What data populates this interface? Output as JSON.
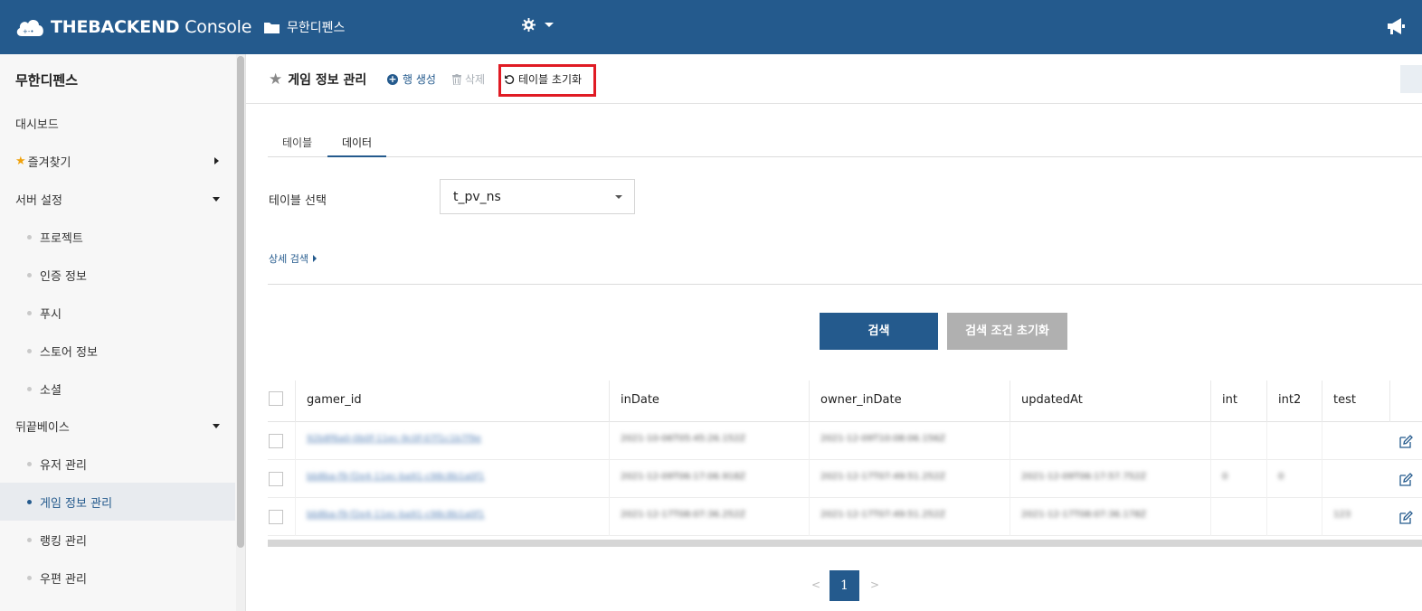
{
  "header": {
    "logo_bold": "THEBACKEND",
    "logo_light": " Console",
    "project_name": "무한디펜스",
    "icons": [
      "cloud-logo-icon",
      "folder-icon",
      "gear-icon",
      "megaphone-icon"
    ]
  },
  "sidebar": {
    "project": "무한디펜스",
    "items": [
      {
        "label": "대시보드"
      },
      {
        "label": "즐겨찾기"
      },
      {
        "label": "서버 설정"
      },
      {
        "label": "프로젝트"
      },
      {
        "label": "인증 정보"
      },
      {
        "label": "푸시"
      },
      {
        "label": "스토어 정보"
      },
      {
        "label": "소셜"
      },
      {
        "label": "뒤끝베이스"
      },
      {
        "label": "유저 관리"
      },
      {
        "label": "게임 정보 관리"
      },
      {
        "label": "랭킹 관리"
      },
      {
        "label": "우편 관리"
      }
    ]
  },
  "page": {
    "title": "게임 정보 관리",
    "actions": {
      "create_row": "행 생성",
      "delete": "삭제",
      "reset_table": "테이블 초기화"
    },
    "tabs": [
      "테이블",
      "데이터"
    ],
    "active_tab": "데이터"
  },
  "filters": {
    "table_select_label": "테이블 선택",
    "table_select_value": "t_pv_ns",
    "advanced_search": "상세 검색",
    "search_button": "검색",
    "reset_conditions_button": "검색 조건 초기화"
  },
  "table": {
    "columns": [
      "gamer_id",
      "inDate",
      "owner_inDate",
      "updatedAt",
      "int",
      "int2",
      "test"
    ],
    "rows": [
      {
        "gamer_id": "92b8f6a0-0b0f-11ec-9c0f-07f1c1b7f9e",
        "inDate": "2021-10-06T05:45:26.152Z",
        "owner_inDate": "2021-12-09T10:08:06.156Z",
        "updatedAt": "",
        "int": "",
        "int2": "",
        "test": ""
      },
      {
        "gamer_id": "bb8ba-f9-f2e4-11ec-ba91-c98c8b1a0f1",
        "inDate": "2021-12-09T06:17:06.918Z",
        "owner_inDate": "2021-12-17T07:49:51.252Z",
        "updatedAt": "2021-12-09T06:17:57.752Z",
        "int": "0",
        "int2": "0",
        "test": ""
      },
      {
        "gamer_id": "bb8ba-f9-f2e4-11ec-ba91-c98c8b1a0f1",
        "inDate": "2021-12-17T08:07:36.252Z",
        "owner_inDate": "2021-12-17T07:49:51.252Z",
        "updatedAt": "2021-12-17T08:07:36.178Z",
        "int": "",
        "int2": "",
        "test": "123"
      }
    ]
  },
  "pagination": {
    "prev": "<",
    "current": "1",
    "next": ">"
  },
  "colors": {
    "brand": "#245a8d",
    "highlight": "#e01b24",
    "star": "#f0a20c"
  }
}
